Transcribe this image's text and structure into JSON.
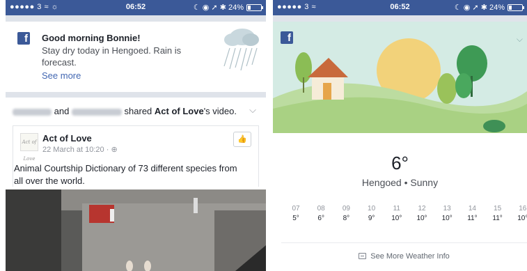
{
  "left_phone": {
    "status": {
      "carrier": "●●●●● 3 ≈ ☼",
      "time": "06:52",
      "indicators": "☾ ◉ ➚ ✱ 24%",
      "battery_level": 0.24
    },
    "greeting": {
      "title": "Good morning Bonnie!",
      "body": "Stay dry today in Hengoed. Rain is forecast.",
      "link": "See more",
      "icon": "rain-cloud-icon"
    },
    "shared": {
      "connector": " and ",
      "action": " shared ",
      "page": "Act of Love",
      "suffix": "'s video."
    },
    "post": {
      "page_name": "Act of Love",
      "avatar_text": "Act of Love",
      "date": "22 March at 10:20 · ⊕",
      "text": "Animal Courtship Dictionary of 73 different species from all over the world."
    }
  },
  "right_phone": {
    "status": {
      "carrier": "●●●●● 3 ≈",
      "time": "06:52",
      "indicators": "☾ ◉ ➚ ✱ 24%",
      "battery_level": 0.24
    },
    "weather": {
      "temperature": "6°",
      "location": "Hengoed • Sunny",
      "hourly": [
        {
          "hour": "07",
          "temp": "5°"
        },
        {
          "hour": "08",
          "temp": "6°"
        },
        {
          "hour": "09",
          "temp": "8°"
        },
        {
          "hour": "10",
          "temp": "9°"
        },
        {
          "hour": "11",
          "temp": "10°"
        },
        {
          "hour": "12",
          "temp": "10°"
        },
        {
          "hour": "13",
          "temp": "10°"
        },
        {
          "hour": "14",
          "temp": "11°"
        },
        {
          "hour": "15",
          "temp": "11°"
        },
        {
          "hour": "16",
          "temp": "10°"
        }
      ],
      "more_label": "See More Weather Info"
    }
  },
  "colors": {
    "facebook_blue": "#3b5998",
    "link_blue": "#4267b2"
  }
}
